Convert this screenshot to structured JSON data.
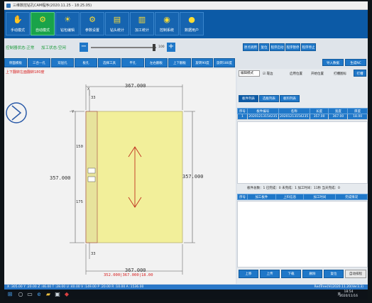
{
  "window": {
    "title": "三维数控钻孔CAM程序(2020.11.25 - 18:25.05)"
  },
  "toolbar": {
    "buttons": [
      {
        "label": "手动模式",
        "icon": "hand-icon"
      },
      {
        "label": "自动模式",
        "icon": "auto-icon"
      },
      {
        "label": "钻包编辑",
        "icon": "drill-icon"
      },
      {
        "label": "参数设置",
        "icon": "gear-icon"
      },
      {
        "label": "钻头统计",
        "icon": "chart-icon"
      },
      {
        "label": "加工统计",
        "icon": "stats-icon"
      },
      {
        "label": "控制系统",
        "icon": "control-icon"
      },
      {
        "label": "数据用户",
        "icon": "user-icon"
      }
    ]
  },
  "status": {
    "device_state": "控制器状态:正常",
    "process_state": "加工状态:空闲",
    "speed_value": "100",
    "buttons": [
      "原点调用",
      "复位",
      "程序启动",
      "程序暂停",
      "程序停止"
    ]
  },
  "toolbar2": {
    "buttons": [
      "侧面模板",
      "三合一孔",
      "双层孔",
      "板孔",
      "选择工具",
      "平孔",
      "左右翻板",
      "上下翻板",
      "旋转90度",
      "旋转180度"
    ]
  },
  "right_header": {
    "import_label": "导入数据",
    "generate_label": "生成NC",
    "mode_value": "编辑模式",
    "check_label": "靠边",
    "col_labels": [
      "启用位置",
      "开始位置",
      "打槽图标"
    ],
    "extra_btn": "打槽"
  },
  "parts_tabs": [
    "板件列表",
    "选板列表",
    "板料列表"
  ],
  "parts_table": {
    "headers": [
      "序号",
      "板件编号",
      "名称",
      "长度",
      "宽度",
      "厚度"
    ],
    "rows": [
      [
        "1",
        "20201213154235",
        "20201213154235",
        "357.00",
        "367.00",
        "18.00"
      ]
    ]
  },
  "summary": {
    "text": "板件总数：1  已完成：0  未完成：1  加工时间：11秒  当天完成：0"
  },
  "log_table": {
    "headers": [
      "序号",
      "加工板件",
      "上料信息",
      "加工时间",
      "完成情况"
    ]
  },
  "bottom_buttons": [
    "上移",
    "上传",
    "下载",
    "删除",
    "复位",
    "自动排程"
  ],
  "drawing": {
    "warning": "上下翻转左面翻转180度",
    "dims": {
      "top_width": "367.000",
      "bottom_width": "367.000",
      "left_height": "357.000",
      "right_height": "357.000",
      "margin_top": "33",
      "margin_bottom": "33",
      "segment_upper": "150",
      "segment_lower": "175",
      "footer": "352.000|367.000|18.00"
    },
    "axis_x": "X",
    "axis_y": "Y"
  },
  "coordinates": {
    "text": "X :305.00 Y :20.00 Z :46.00 T :28.00 U :40.00 V :149.00 P :20.00 R :10.00 A :1536.00",
    "version": "RedTree(Vi)2020.11.20(Ver3.3)"
  },
  "taskbar": {
    "language": "英",
    "time": "18:54",
    "date": "2020/11/16"
  }
}
